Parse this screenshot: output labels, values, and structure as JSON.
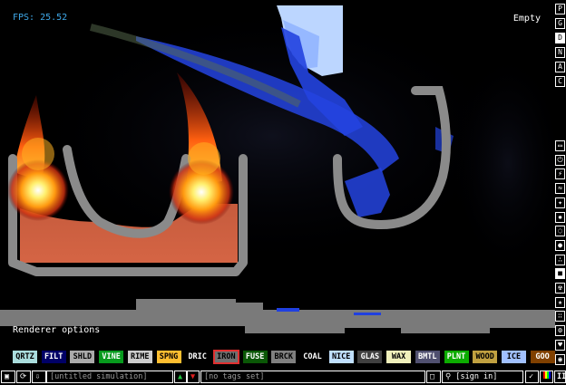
{
  "fps": "FPS: 25.52",
  "hover_label": "Empty",
  "renderer_options": "Renderer options",
  "menu_letters": [
    "P",
    "G",
    "D",
    "N",
    "A",
    "C"
  ],
  "menu_selected": "D",
  "tool_icons": [
    "display-icon",
    "electronics-icon",
    "powered-icon",
    "sensor-icon",
    "force-icon",
    "explosive-icon",
    "gas-icon",
    "liquid-icon",
    "powders-icon",
    "solids-icon",
    "radioactive-icon",
    "special-icon",
    "life-icon",
    "tools-icon",
    "favorites-icon",
    "decoration-icon"
  ],
  "elements": [
    {
      "label": "QRTZ",
      "bg": "#aadddd",
      "fg": "#000000"
    },
    {
      "label": "FILT",
      "bg": "#000066",
      "fg": "#ffffff"
    },
    {
      "label": "SHLD",
      "bg": "#aaaaaa",
      "fg": "#000000"
    },
    {
      "label": "VINE",
      "bg": "#079a1d",
      "fg": "#ffffff"
    },
    {
      "label": "RIME",
      "bg": "#cccccc",
      "fg": "#000000"
    },
    {
      "label": "SPNG",
      "bg": "#ffbe30",
      "fg": "#000000"
    },
    {
      "label": "DRIC",
      "bg": "#000000",
      "fg": "#ffffff"
    },
    {
      "label": "IRON",
      "bg": "#707070",
      "fg": "#000000",
      "selected": true
    },
    {
      "label": "FUSE",
      "bg": "#0a5706",
      "fg": "#ffffff"
    },
    {
      "label": "BRCK",
      "bg": "#808080",
      "fg": "#000000"
    },
    {
      "label": "COAL",
      "bg": "#000000",
      "fg": "#ffffff"
    },
    {
      "label": "NICE",
      "bg": "#c0e0ff",
      "fg": "#000000"
    },
    {
      "label": "GLAS",
      "bg": "#404040",
      "fg": "#ffffff"
    },
    {
      "label": "WAX",
      "bg": "#f0f0bb",
      "fg": "#000000"
    },
    {
      "label": "BMTL",
      "bg": "#505070",
      "fg": "#ffffff"
    },
    {
      "label": "PLNT",
      "bg": "#0cac00",
      "fg": "#ffffff"
    },
    {
      "label": "WOOD",
      "bg": "#c0a040",
      "fg": "#000000"
    },
    {
      "label": "ICE",
      "bg": "#a0c0ff",
      "fg": "#000000"
    },
    {
      "label": "GOO",
      "bg": "#804000",
      "fg": "#ffffff"
    }
  ],
  "toolbar": {
    "simulation_name": "[untitled simulation]",
    "tags": "[no tags set]",
    "sign_in": "[sign in]"
  },
  "colors": {
    "fps": "#3fa8e8",
    "brick": "#808080",
    "water": "#2040e0"
  }
}
